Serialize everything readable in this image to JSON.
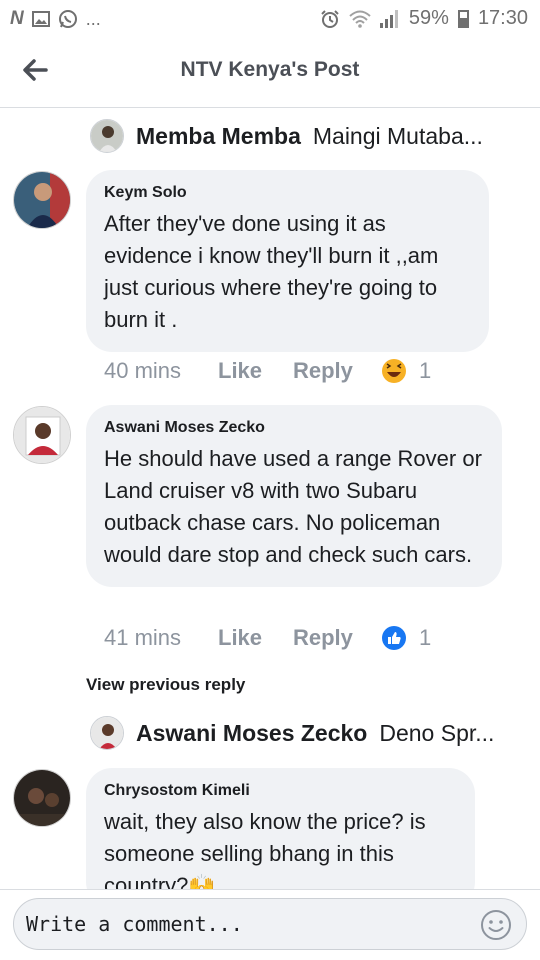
{
  "status_bar": {
    "left_icons": [
      "netflix-icon",
      "gallery-icon",
      "whatsapp-icon",
      "more-icon"
    ],
    "more": "...",
    "battery": "59%",
    "time": "17:30"
  },
  "header": {
    "title": "NTV Kenya's Post"
  },
  "threads": {
    "reply_top": {
      "name": "Memba Memba",
      "snippet": "Maingi Mutaba..."
    },
    "comment1": {
      "author": "Keym Solo",
      "text": "After they've done using it as evidence i know they'll burn it ,,am just curious where they're going to burn it .",
      "time": "40 mins",
      "like": "Like",
      "reply": "Reply",
      "reaction_icon": "laugh-reaction-icon",
      "reaction_count": "1"
    },
    "comment2": {
      "author": "Aswani Moses Zecko",
      "text": "He should have used a range Rover or Land cruiser v8 with two Subaru outback chase cars. No policeman would dare stop and check such cars.",
      "time": "41 mins",
      "like": "Like",
      "reply": "Reply",
      "reaction_icon": "like-reaction-icon",
      "reaction_count": "1"
    },
    "view_previous": "View previous reply",
    "reply_bottom": {
      "name": "Aswani Moses Zecko",
      "snippet": "Deno Spr..."
    },
    "comment3": {
      "author": "Chrysostom Kimeli",
      "text": "wait, they also know the price? is someone selling bhang in this country?🙌"
    }
  },
  "composer": {
    "placeholder": "Write a comment...",
    "emoji_icon": "smiley-icon"
  },
  "colors": {
    "bubble": "#f0f2f5",
    "meta_gray": "#8d949e",
    "header_text": "#4b4f56",
    "like_blue": "#1877f2",
    "laugh_yellow": "#f7b125"
  }
}
